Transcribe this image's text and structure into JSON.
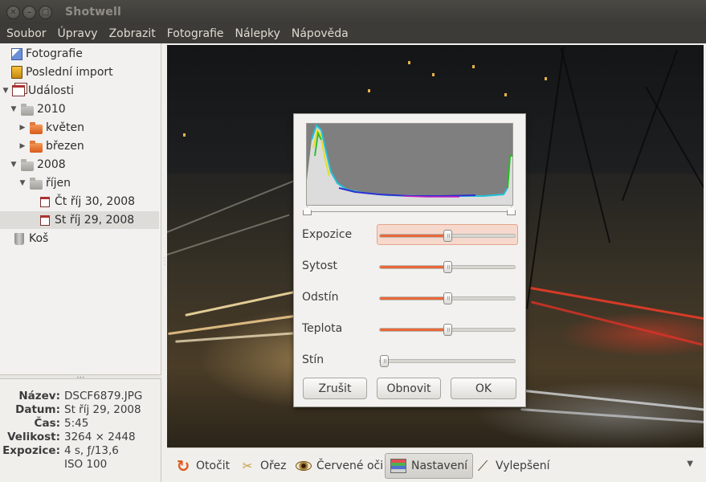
{
  "window": {
    "title": "Shotwell",
    "buttons": [
      "close",
      "minimize",
      "maximize"
    ]
  },
  "menu": [
    "Soubor",
    "Úpravy",
    "Zobrazit",
    "Fotografie",
    "Nálepky",
    "Nápověda"
  ],
  "sidebar": {
    "items": [
      {
        "label": "Fotografie",
        "icon": "photos-icon"
      },
      {
        "label": "Poslední import",
        "icon": "import-icon"
      },
      {
        "label": "Události",
        "icon": "events-icon",
        "expanded": true
      },
      {
        "label": "2010",
        "icon": "folder-icon",
        "expanded": true
      },
      {
        "label": "květen",
        "icon": "folder-icon",
        "expanded": false
      },
      {
        "label": "březen",
        "icon": "folder-icon",
        "expanded": false
      },
      {
        "label": "2008",
        "icon": "folder-icon",
        "expanded": true
      },
      {
        "label": "říjen",
        "icon": "folder-icon",
        "expanded": true
      },
      {
        "label": "Čt říj 30, 2008",
        "icon": "calendar-icon"
      },
      {
        "label": "St říj 29, 2008",
        "icon": "calendar-icon",
        "selected": true
      },
      {
        "label": "Koš",
        "icon": "trash-icon"
      }
    ]
  },
  "metadata": {
    "rows": [
      {
        "label": "Název:",
        "value": "DSCF6879.JPG"
      },
      {
        "label": "Datum:",
        "value": "St říj 29, 2008"
      },
      {
        "label": "Čas:",
        "value": "5:45"
      },
      {
        "label": "Velikost:",
        "value": "3264 × 2448"
      },
      {
        "label": "Expozice:",
        "value": "4 s, ƒ/13,6"
      },
      {
        "label": "",
        "value": "ISO 100"
      }
    ]
  },
  "adjust_dialog": {
    "sliders": [
      {
        "label": "Expozice",
        "level": 0.5,
        "highlighted": true
      },
      {
        "label": "Sytost",
        "level": 0.5
      },
      {
        "label": "Odstín",
        "level": 0.5
      },
      {
        "label": "Teplota",
        "level": 0.5
      },
      {
        "label": "Stín",
        "level": 0.0
      }
    ],
    "buttons": {
      "cancel": "Zrušit",
      "reset": "Obnovit",
      "ok": "OK"
    }
  },
  "toolbar": {
    "rotate": "Otočit",
    "crop": "Ořez",
    "redeye": "Červené oči",
    "adjust": "Nastavení",
    "enhance": "Vylepšení"
  },
  "colors": {
    "accent": "#e8683a",
    "menubar": "#3c3b37",
    "titlebar": "#3b3a36"
  }
}
